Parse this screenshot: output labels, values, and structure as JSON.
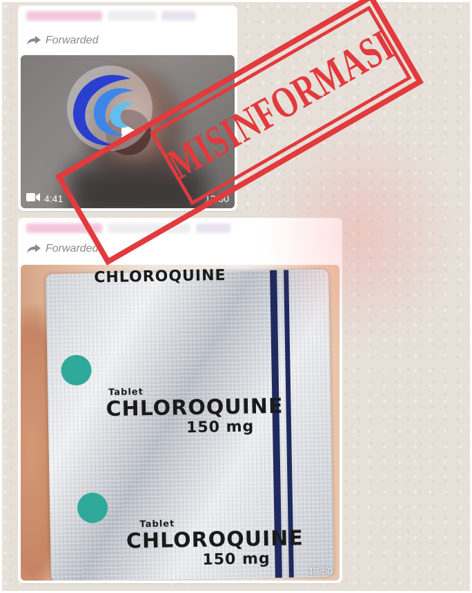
{
  "message1": {
    "forwarded_label": "Forwarded",
    "video_duration": "4:41",
    "timestamp": "13:50",
    "icons": [
      "forwarded-icon",
      "play-icon",
      "video-camera-icon"
    ]
  },
  "message2": {
    "forwarded_label": "Forwarded",
    "timestamp": "13:50",
    "photo_text": {
      "top_fragment": "CHLOROQUINE",
      "tablet_label": "Tablet",
      "drug_name_1": "CHLOROQUINE",
      "dose_1": "150 mg",
      "drug_name_2": "CHLOROQUINE",
      "dose_2": "150 mg"
    }
  },
  "stamp": {
    "text": "MISINFORMASI",
    "color": "#e23a3d"
  },
  "colors": {
    "bubble": "#ffffff",
    "background": "#e6e0d9",
    "muted_text": "#8a8a8a"
  }
}
